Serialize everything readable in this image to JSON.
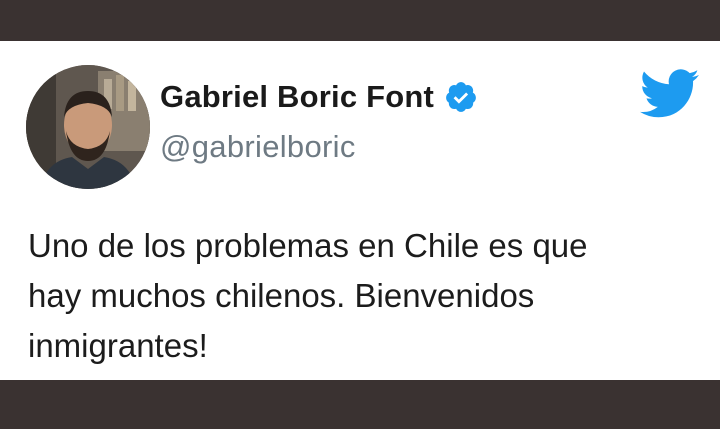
{
  "tweet": {
    "display_name": "Gabriel Boric Font",
    "handle": "@gabrielboric",
    "verified": true,
    "text_lines": [
      "Uno de los problemas en Chile es que",
      "hay muchos chilenos. Bienvenidos",
      "inmigrantes!"
    ]
  },
  "icons": {
    "verified": "verified-badge-icon",
    "brand": "twitter-bird-icon"
  },
  "colors": {
    "background": "#3a3231",
    "card": "#ffffff",
    "brand_blue": "#1d9bf0",
    "handle_gray": "#6e7a83"
  }
}
